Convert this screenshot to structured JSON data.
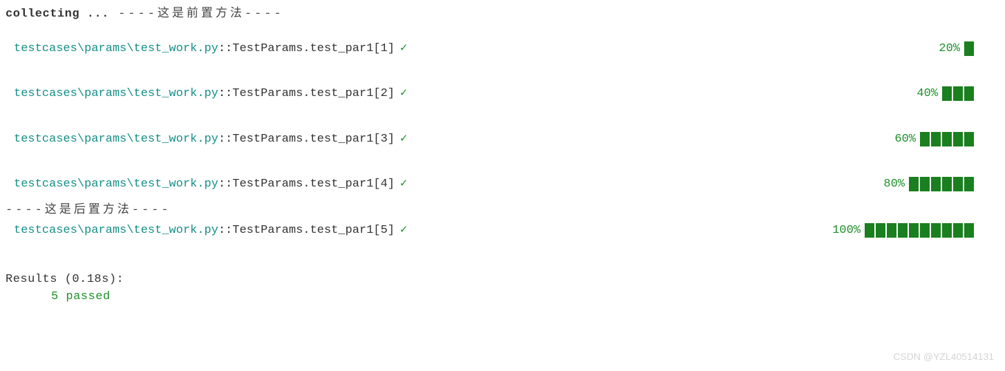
{
  "header": {
    "collecting": "collecting ...",
    "setup_message": " ----这是前置方法----"
  },
  "tests": [
    {
      "path": "testcases\\params\\test_work.py",
      "name": "::TestParams.test_par1[1]",
      "status": "✓",
      "percent": "20%",
      "blocks": 1
    },
    {
      "path": "testcases\\params\\test_work.py",
      "name": "::TestParams.test_par1[2]",
      "status": "✓",
      "percent": "40%",
      "blocks": 3
    },
    {
      "path": "testcases\\params\\test_work.py",
      "name": "::TestParams.test_par1[3]",
      "status": "✓",
      "percent": "60%",
      "blocks": 5
    },
    {
      "path": "testcases\\params\\test_work.py",
      "name": "::TestParams.test_par1[4]",
      "status": "✓",
      "percent": "80%",
      "blocks": 6
    },
    {
      "path": "testcases\\params\\test_work.py",
      "name": "::TestParams.test_par1[5]",
      "status": "✓",
      "percent": "100%",
      "blocks": 10
    }
  ],
  "teardown_message": "----这是后置方法----",
  "results": {
    "header": "Results (0.18s):",
    "passed": "5 passed"
  },
  "watermark": "CSDN @YZL40514131"
}
